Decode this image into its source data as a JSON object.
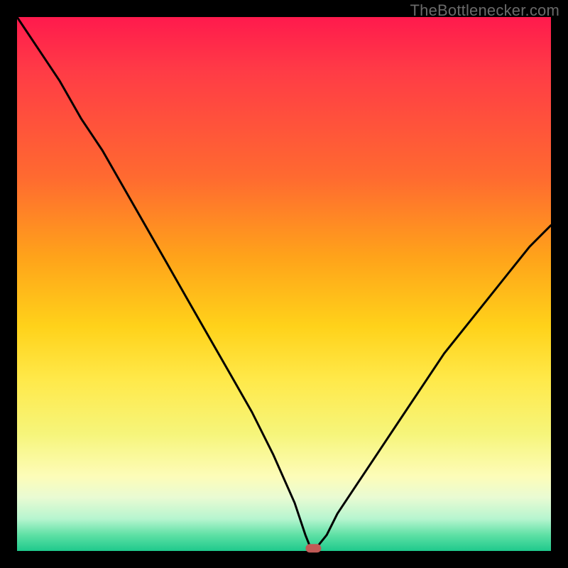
{
  "watermark": "TheBottlenecker.com",
  "chart_data": {
    "type": "line",
    "title": "",
    "xlabel": "",
    "ylabel": "",
    "xlim": [
      0,
      100
    ],
    "ylim": [
      0,
      100
    ],
    "x": [
      0,
      4,
      8,
      12,
      16,
      20,
      24,
      28,
      32,
      36,
      40,
      44,
      48,
      52,
      54,
      55,
      56,
      58,
      60,
      64,
      68,
      72,
      76,
      80,
      84,
      88,
      92,
      96,
      100
    ],
    "values": [
      100,
      94,
      88,
      81,
      75,
      68,
      61,
      54,
      47,
      40,
      33,
      26,
      18,
      9,
      3,
      0.5,
      0.5,
      3,
      7,
      13,
      19,
      25,
      31,
      37,
      42,
      47,
      52,
      57,
      61
    ],
    "marker": {
      "x": 55.5,
      "y": 0.5,
      "shape": "pill",
      "color": "#c15a56"
    },
    "grid": false,
    "legend": false
  },
  "colors": {
    "background": "#000000",
    "watermark": "#6a6a6a",
    "curve": "#000000",
    "marker": "#c15a56"
  }
}
